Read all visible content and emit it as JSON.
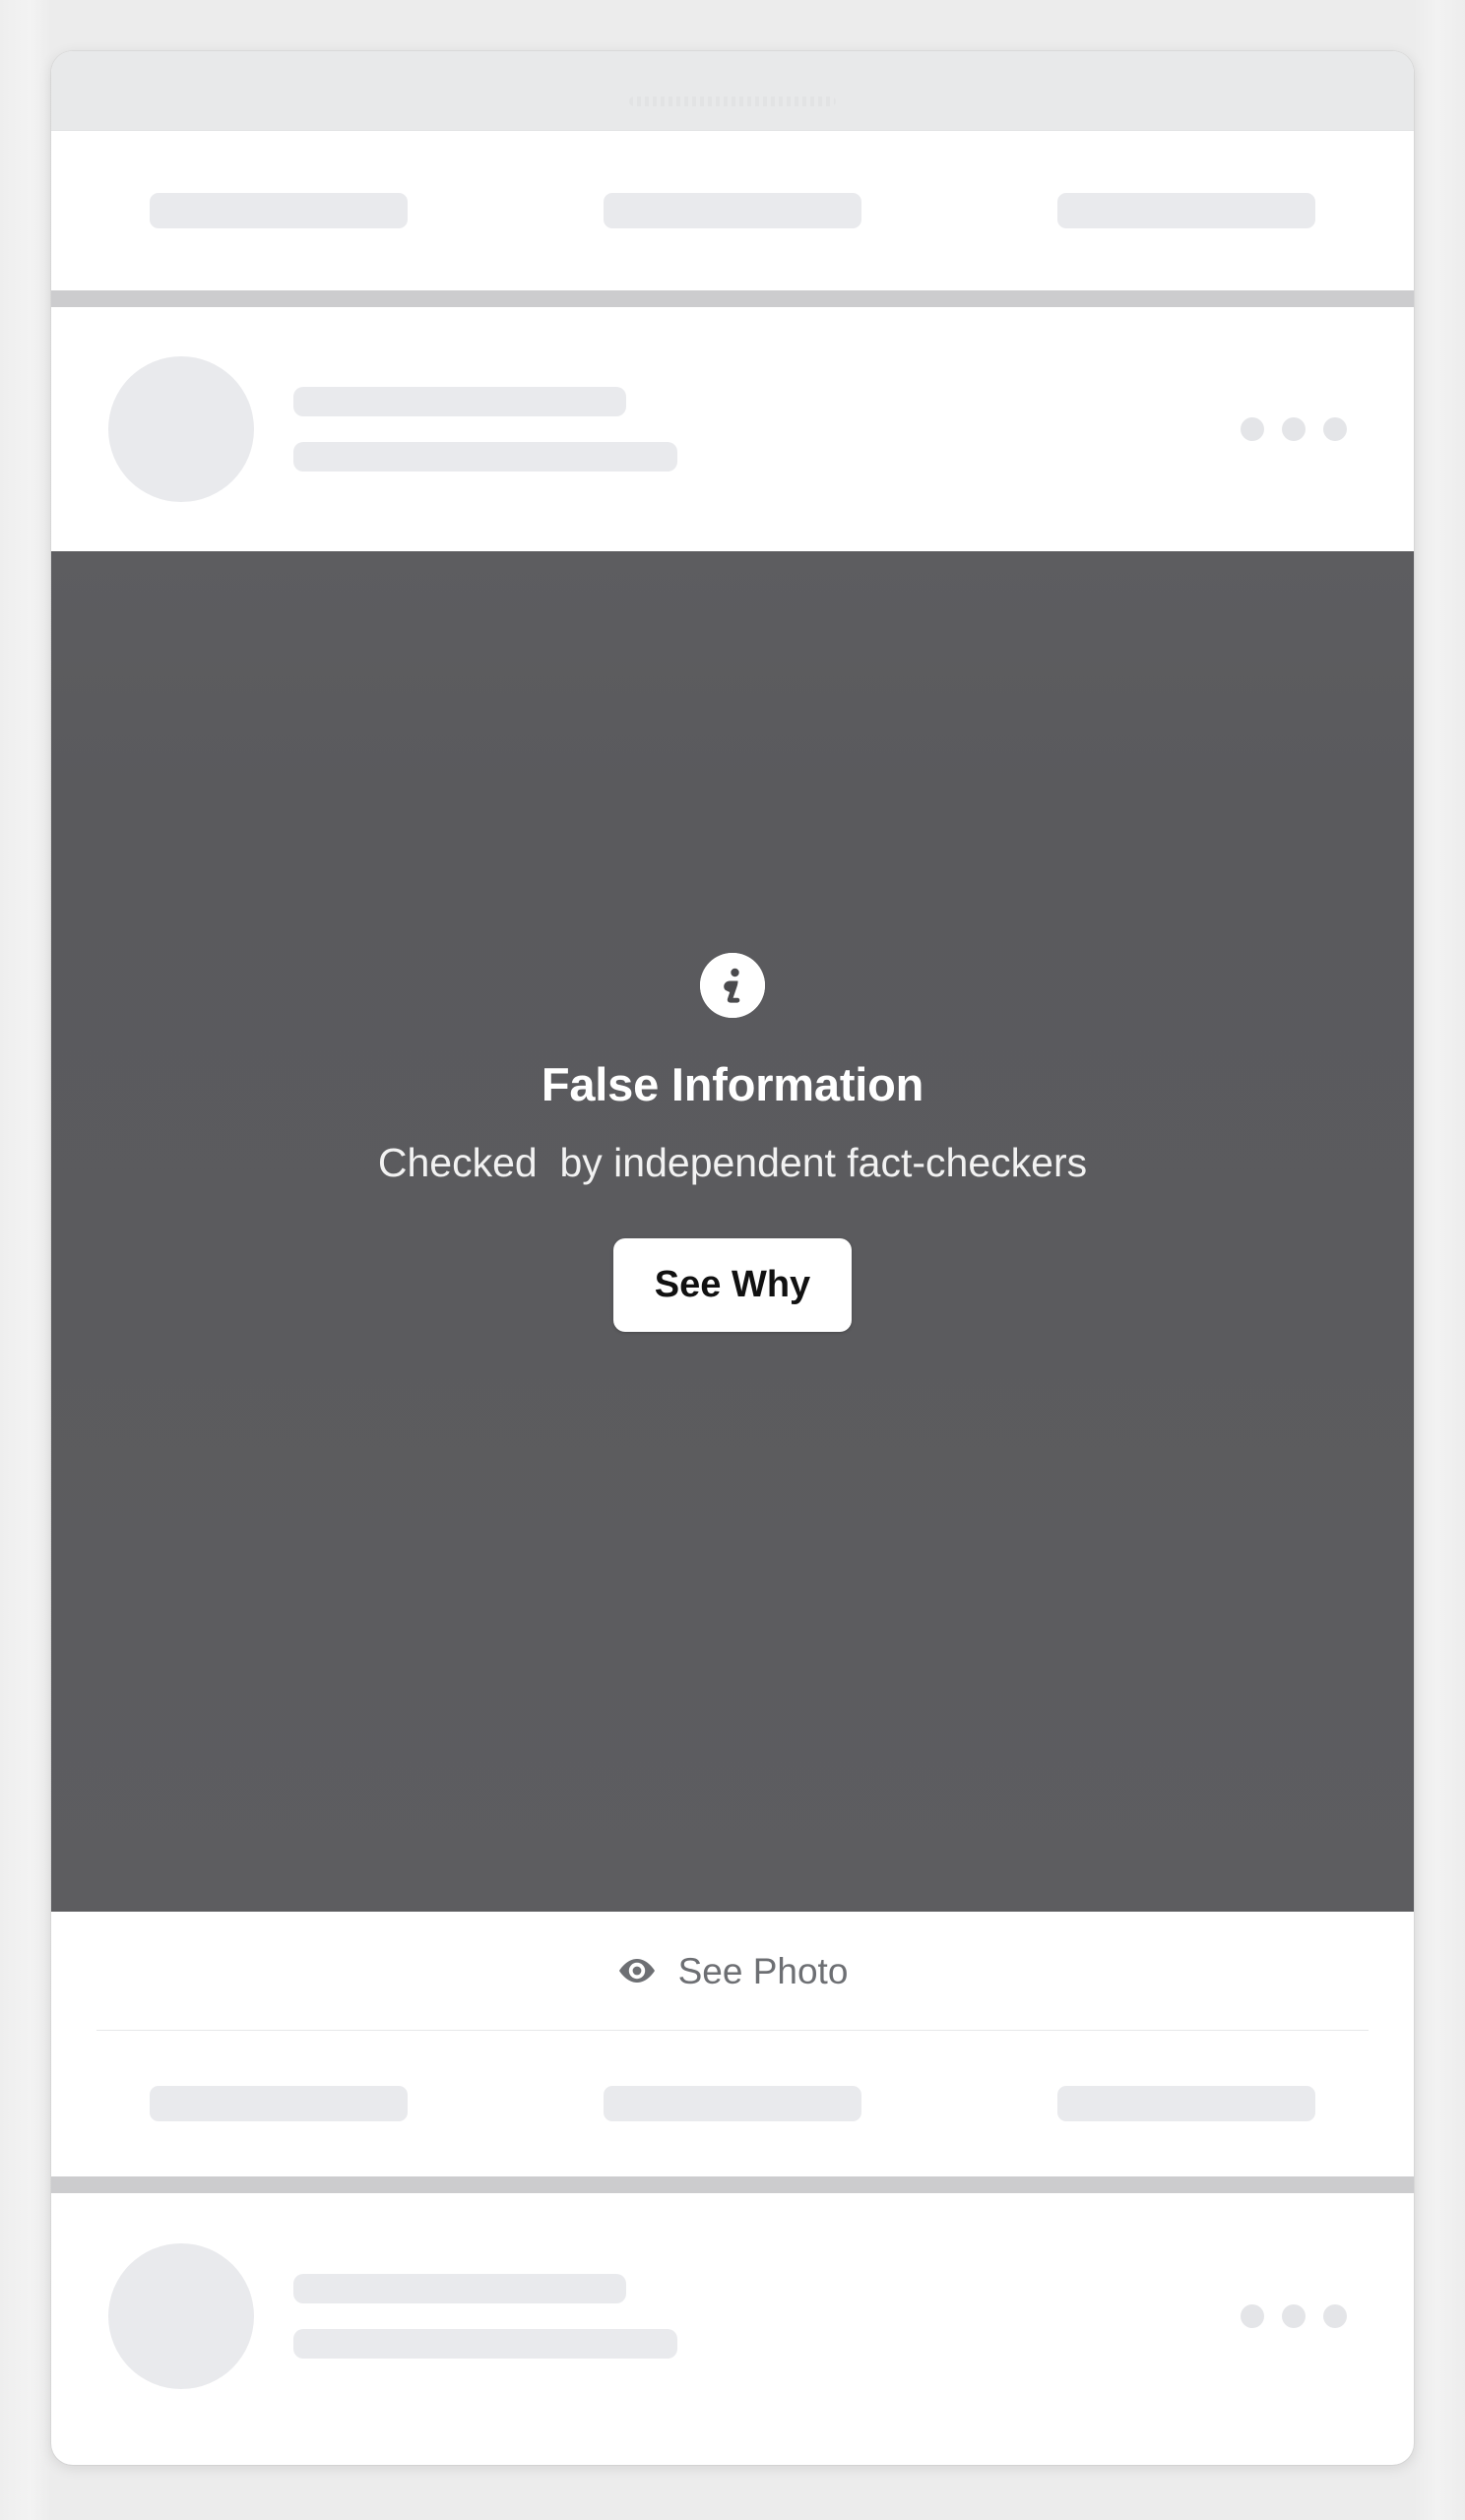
{
  "app": {
    "background_color": "#efefef",
    "card_background": "#ffffff",
    "separator_color": "#ccccce",
    "skeleton_color": "#e9eaed"
  },
  "chrome": {
    "grille_name": "speaker-grille"
  },
  "top_nav": {
    "placeholders": [
      "",
      "",
      ""
    ]
  },
  "post": {
    "header": {
      "avatar_placeholder": "",
      "name_placeholder": "",
      "meta_placeholder": "",
      "overflow_menu": "•••"
    },
    "overlay": {
      "icon": "info-circle-icon",
      "title": "False Information",
      "subtitle": "Checked  by independent fact-checkers",
      "button_label": "See Why",
      "overlay_color": "#5b5b5e",
      "title_color": "#ffffff",
      "button_background": "#ffffff",
      "button_text_color": "#111111"
    },
    "reveal": {
      "icon": "eye-icon",
      "label": "See Photo",
      "label_color": "#6d6f73"
    },
    "actions": {
      "placeholders": [
        "",
        "",
        ""
      ]
    }
  },
  "next_post": {
    "header": {
      "avatar_placeholder": "",
      "name_placeholder": "",
      "meta_placeholder": "",
      "overflow_menu": "•••"
    }
  }
}
